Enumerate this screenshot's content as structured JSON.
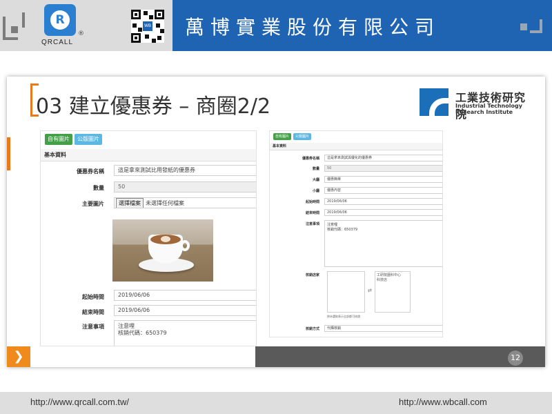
{
  "header": {
    "brand_name": "QRCALL",
    "registered_mark": "®",
    "logo_letter": "R",
    "qr_badge": "WB",
    "company_name": "萬博實業股份有限公司",
    "colors": {
      "primary": "#1f63b3",
      "accent": "#e8791c"
    }
  },
  "slide": {
    "title": "03 建立優惠券 – 商圈2/2",
    "institute": {
      "name_zh": "工業技術研究院",
      "name_en": "Industrial Technology Research Institute"
    },
    "page_number": "12"
  },
  "left_form": {
    "tabs": [
      "自有圖片",
      "公版圖片"
    ],
    "section": "基本資料",
    "fields": [
      {
        "label": "優惠券名稱",
        "value": "這是拿來測試比用發紙的優惠券"
      },
      {
        "label": "數量",
        "value": "50"
      },
      {
        "label": "主要圖片",
        "button": "選擇檔案",
        "value": "未選擇任何檔案"
      },
      {
        "label": "起始時間",
        "value": "2019/06/06"
      },
      {
        "label": "結束時間",
        "value": "2019/06/06"
      },
      {
        "label": "注意事項",
        "value": "注意哩\n核銷代碼：650379"
      }
    ]
  },
  "right_form": {
    "tabs": [
      "自有圖片",
      "公版圖片"
    ],
    "section": "基本資料",
    "fields": [
      {
        "label": "優惠券名稱",
        "value": "這是拿來測試與優化的優惠券"
      },
      {
        "label": "數量",
        "value": "50"
      },
      {
        "label": "大廳",
        "value": "優惠簡單"
      },
      {
        "label": "小廳",
        "value": "優惠內容"
      },
      {
        "label": "起始時間",
        "value": "2019/06/06"
      },
      {
        "label": "結束時間",
        "value": "2019/06/06"
      },
      {
        "label": "注意事項",
        "value": "注意哩\n核銷代碼：650379"
      },
      {
        "label": "核銷店家",
        "left_list": "",
        "arrow": "⇄",
        "right_list": "工研院園科中心\n科技店",
        "hint": "按未選取表示全部都可核銷"
      },
      {
        "label": "核銷方式",
        "value": "代購核銷"
      }
    ]
  },
  "footer": {
    "url_left": "http://www.qrcall.com.tw/",
    "url_right": "http://www.wbcall.com"
  }
}
